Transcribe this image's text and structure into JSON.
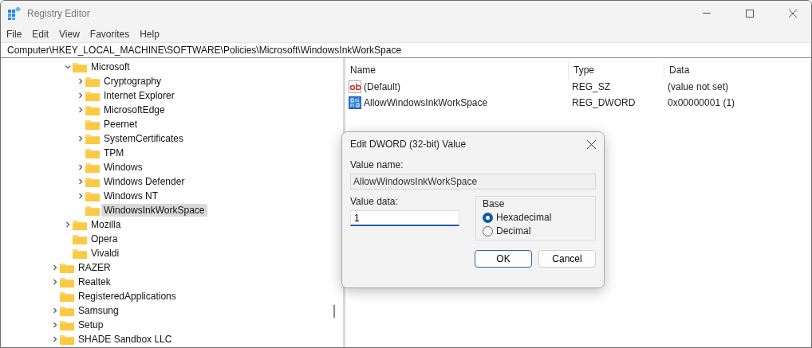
{
  "window": {
    "title": "Registry Editor"
  },
  "menu": [
    "File",
    "Edit",
    "View",
    "Favorites",
    "Help"
  ],
  "address": "Computer\\HKEY_LOCAL_MACHINE\\SOFTWARE\\Policies\\Microsoft\\WindowsInkWorkSpace",
  "tree": {
    "open_branch": [
      {
        "label": "Microsoft",
        "expandable": true,
        "expanded": true,
        "selected": false,
        "children": [
          {
            "label": "Cryptography",
            "expandable": true,
            "expanded": false,
            "selected": false
          },
          {
            "label": "Internet Explorer",
            "expandable": true,
            "expanded": false,
            "selected": false
          },
          {
            "label": "MicrosoftEdge",
            "expandable": true,
            "expanded": false,
            "selected": false
          },
          {
            "label": "Peernet",
            "expandable": false,
            "expanded": false,
            "selected": false
          },
          {
            "label": "SystemCertificates",
            "expandable": true,
            "expanded": false,
            "selected": false
          },
          {
            "label": "TPM",
            "expandable": false,
            "expanded": false,
            "selected": false
          },
          {
            "label": "Windows",
            "expandable": true,
            "expanded": false,
            "selected": false
          },
          {
            "label": "Windows Defender",
            "expandable": true,
            "expanded": false,
            "selected": false
          },
          {
            "label": "Windows NT",
            "expandable": true,
            "expanded": false,
            "selected": false
          },
          {
            "label": "WindowsInkWorkSpace",
            "expandable": false,
            "expanded": false,
            "selected": true
          }
        ]
      },
      {
        "label": "Mozilla",
        "expandable": true,
        "expanded": false,
        "selected": false
      },
      {
        "label": "Opera",
        "expandable": false,
        "expanded": false,
        "selected": false
      },
      {
        "label": "Vivaldi",
        "expandable": false,
        "expanded": false,
        "selected": false
      }
    ],
    "items": [
      {
        "label": "RAZER",
        "expandable": true,
        "expanded": false,
        "selected": false
      },
      {
        "label": "Realtek",
        "expandable": true,
        "expanded": false,
        "selected": false
      },
      {
        "label": "RegisteredApplications",
        "expandable": false,
        "expanded": false,
        "selected": false
      },
      {
        "label": "Samsung",
        "expandable": true,
        "expanded": false,
        "selected": false
      },
      {
        "label": "Setup",
        "expandable": true,
        "expanded": false,
        "selected": false
      },
      {
        "label": "SHADE Sandbox LLC",
        "expandable": true,
        "expanded": false,
        "selected": false
      }
    ]
  },
  "values": {
    "columns": [
      "Name",
      "Type",
      "Data"
    ],
    "rows": [
      {
        "kind": "string",
        "name": "(Default)",
        "type": "REG_SZ",
        "data": "(value not set)"
      },
      {
        "kind": "binary",
        "name": "AllowWindowsInkWorkSpace",
        "type": "REG_DWORD",
        "data": "0x00000001 (1)"
      }
    ]
  },
  "dialog": {
    "title": "Edit DWORD (32-bit) Value",
    "value_name_label": "Value name:",
    "value_name": "AllowWindowsInkWorkSpace",
    "value_data_label": "Value data:",
    "value_data": "1",
    "base_label": "Base",
    "base_options": [
      {
        "label": "Hexadecimal",
        "selected": true
      },
      {
        "label": "Decimal",
        "selected": false
      }
    ],
    "buttons": [
      {
        "label": "OK",
        "kind": "default"
      },
      {
        "label": "Cancel",
        "kind": "normal"
      }
    ]
  }
}
